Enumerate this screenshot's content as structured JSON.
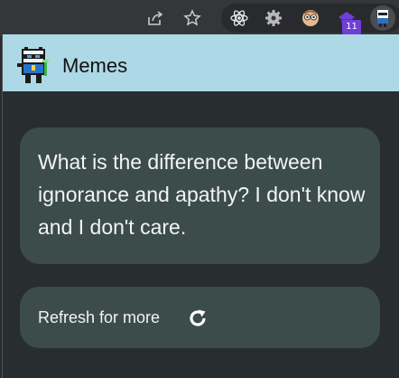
{
  "popup": {
    "title": "Memes",
    "header_color": "#add8e6",
    "card_color": "#3c4c4b"
  },
  "joke": {
    "text": "What is the difference between ignorance and apathy? I don't know and I don't care."
  },
  "refresh": {
    "label": "Refresh for more",
    "icon": "refresh-icon"
  },
  "toolbar": {
    "icons": [
      "share-icon",
      "star-icon",
      "react-icon",
      "gear-icon",
      "face-icon",
      "extension-11-icon",
      "memes-extension-icon"
    ],
    "badge": "11"
  }
}
